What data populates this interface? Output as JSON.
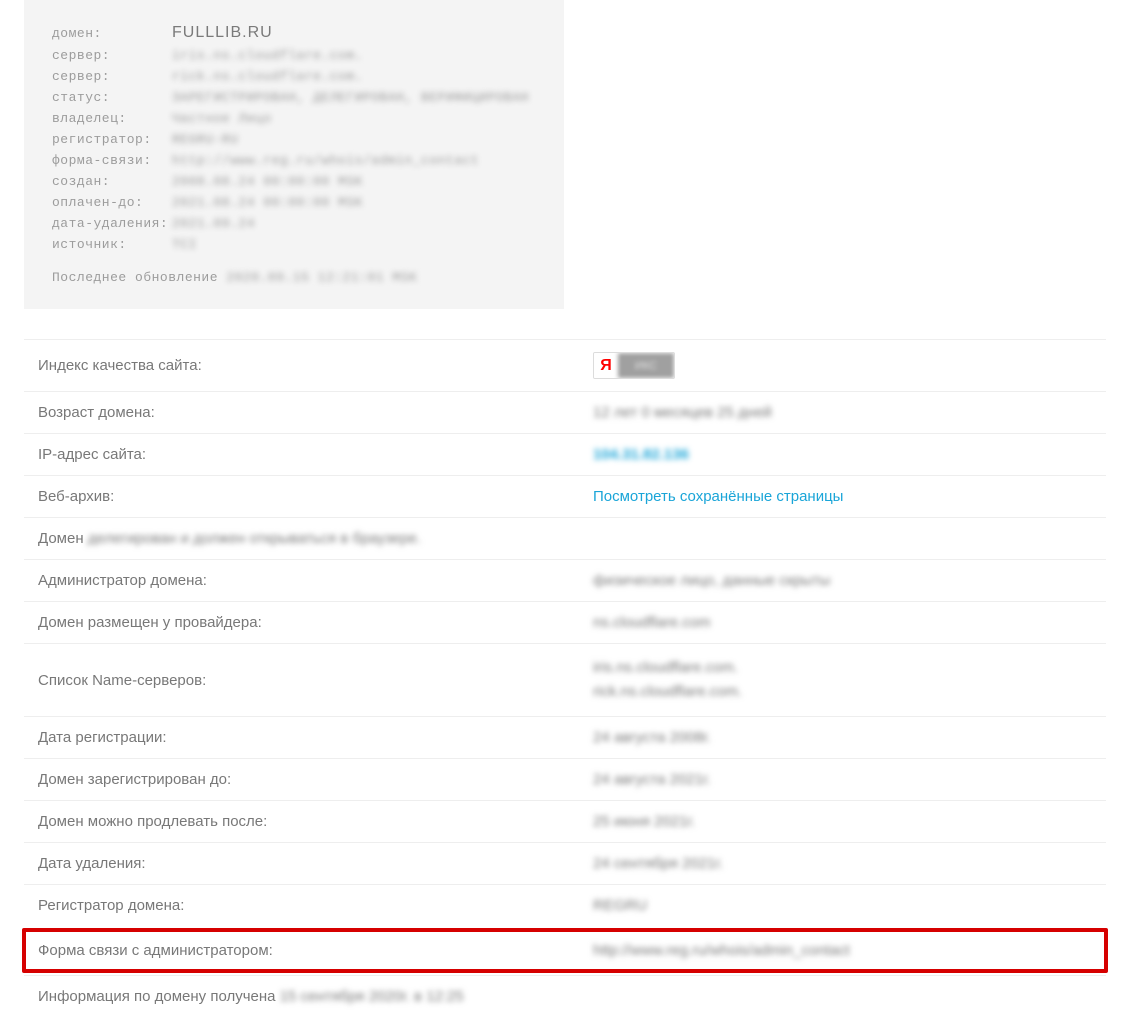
{
  "whois": {
    "rows": [
      {
        "label": "домен:",
        "value": "FULLLIB.RU",
        "clear": true
      },
      {
        "label": "сервер:",
        "value": "iris.ns.cloudflare.com."
      },
      {
        "label": "сервер:",
        "value": "rick.ns.cloudflare.com."
      },
      {
        "label": "статус:",
        "value": "ЗАРЕГИСТРИРОВАН, ДЕЛЕГИРОВАН, ВЕРИФИЦИРОВАН"
      },
      {
        "label": "владелец:",
        "value": "Частное Лицо"
      },
      {
        "label": "регистратор:",
        "value": "REGRU-RU"
      },
      {
        "label": "форма-связи:",
        "value": "http://www.reg.ru/whois/admin_contact"
      },
      {
        "label": "создан:",
        "value": "2008.08.24 00:00:00 MSK"
      },
      {
        "label": "оплачен-до:",
        "value": "2021.08.24 00:00:00 MSK"
      },
      {
        "label": "дата-удаления:",
        "value": "2021.09.24"
      },
      {
        "label": "источник:",
        "value": "TCI"
      }
    ],
    "footer_prefix": "Последнее обновление ",
    "footer_value": "2020.09.15 12:21:01 MSK"
  },
  "info": {
    "quality": {
      "label": "Индекс качества сайта:",
      "badge_char": "Я",
      "badge_rest": "ИКС"
    },
    "age": {
      "label": "Возраст домена:",
      "value": "12 лет 0 месяцев 25 дней"
    },
    "ip": {
      "label": "IP-адрес сайта:",
      "value": "104.31.82.136"
    },
    "archive": {
      "label": "Веб-архив:",
      "value": "Посмотреть сохранённые страницы"
    },
    "domain_line": {
      "prefix": "Домен ",
      "blur": "делегирован и должен открываться в браузере."
    },
    "admin": {
      "label": "Администратор домена:",
      "value": "физическое лицо, данные скрыты"
    },
    "provider": {
      "label": "Домен размещен у провайдера:",
      "value": "ns.cloudflare.com"
    },
    "ns": {
      "label": "Список Name-серверов:",
      "value1": "iris.ns.cloudflare.com.",
      "value2": "rick.ns.cloudflare.com."
    },
    "reg_date": {
      "label": "Дата регистрации:",
      "value": "24 августа 2008г."
    },
    "reg_until": {
      "label": "Домен зарегистрирован до:",
      "value": "24 августа 2021г."
    },
    "renew_after": {
      "label": "Домен можно продлевать после:",
      "value": "25 июня 2021г."
    },
    "del_date": {
      "label": "Дата удаления:",
      "value": "24 сентября 2021г."
    },
    "registrar": {
      "label": "Регистратор домена:",
      "value": "REGRU"
    },
    "contact": {
      "label": "Форма связи с администратором:",
      "value": "http://www.reg.ru/whois/admin_contact"
    },
    "footer": {
      "prefix": "Информация по домену получена ",
      "blur": "15 сентября 2020г. в 12:25"
    }
  }
}
